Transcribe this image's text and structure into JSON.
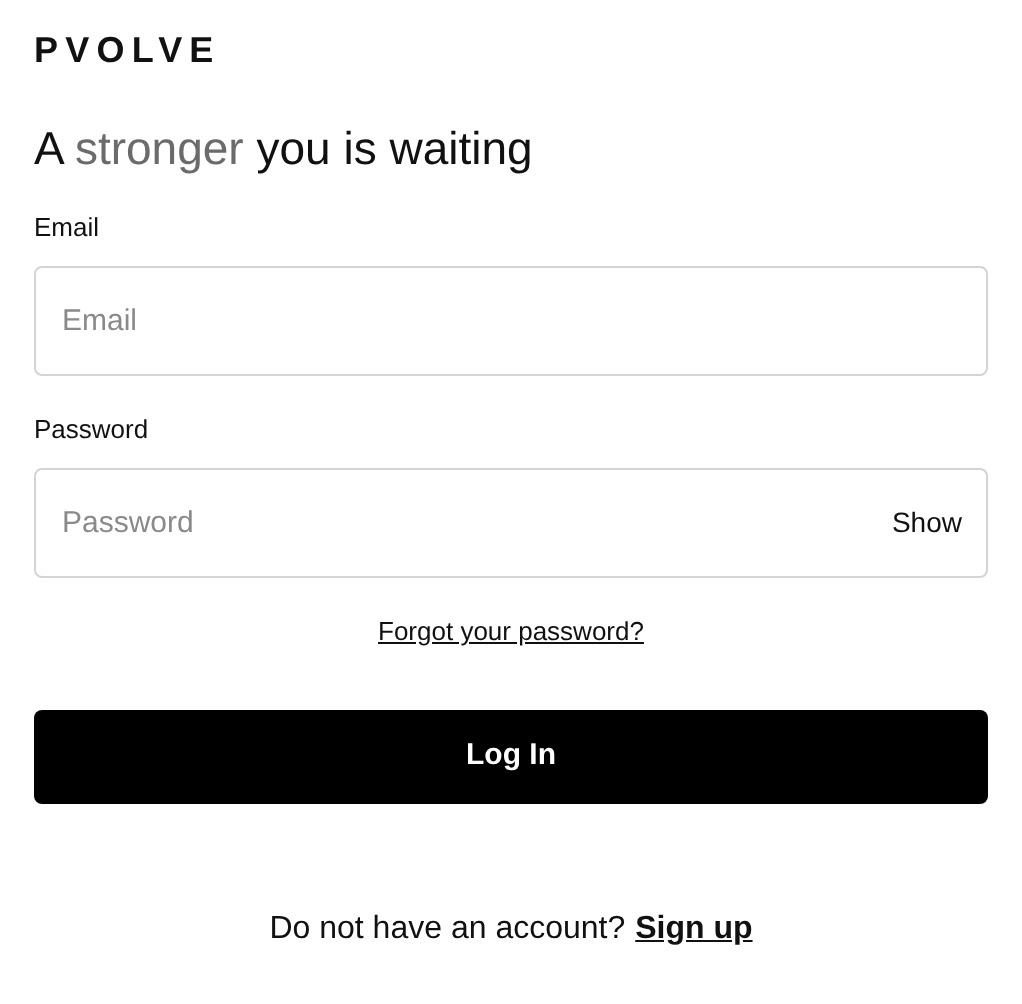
{
  "logo": "PVOLVE",
  "heading": {
    "before": "A",
    "highlight": "stronger",
    "after": "you is waiting"
  },
  "fields": [
    {
      "label": "Email",
      "placeholder": "Email"
    },
    {
      "label": "Password",
      "placeholder": "Password",
      "toggle": "Show"
    }
  ],
  "forgot_link": "Forgot your password?",
  "login_button": "Log In",
  "signup": {
    "text": "Do not have an account?",
    "link": "Sign up"
  }
}
